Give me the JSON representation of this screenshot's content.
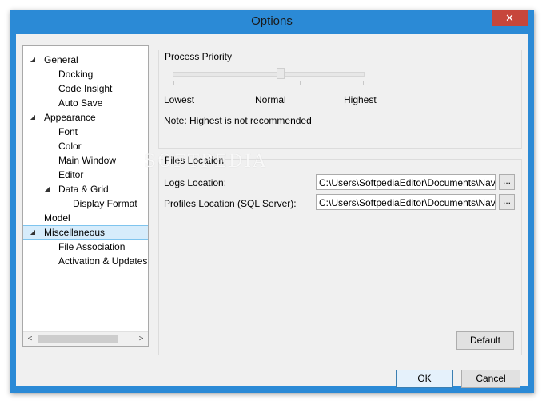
{
  "window": {
    "title": "Options",
    "close_glyph": "✕"
  },
  "tree": {
    "items": [
      {
        "label": "General",
        "expanded": true
      },
      {
        "label": "Docking"
      },
      {
        "label": "Code Insight"
      },
      {
        "label": "Auto Save"
      },
      {
        "label": "Appearance",
        "expanded": true
      },
      {
        "label": "Font"
      },
      {
        "label": "Color"
      },
      {
        "label": "Main Window"
      },
      {
        "label": "Editor"
      },
      {
        "label": "Data & Grid",
        "expanded": true
      },
      {
        "label": "Display Format"
      },
      {
        "label": "Model"
      },
      {
        "label": "Miscellaneous",
        "expanded": true,
        "selected": true
      },
      {
        "label": "File Association"
      },
      {
        "label": "Activation & Updates"
      }
    ],
    "expand_glyph": "◢",
    "scroll_left": "<",
    "scroll_right": ">"
  },
  "process_priority": {
    "title": "Process Priority",
    "labels": {
      "low": "Lowest",
      "mid": "Normal",
      "high": "Highest"
    },
    "value": "Normal",
    "note": "Note: Highest is not recommended"
  },
  "files_location": {
    "title": "Files Location",
    "logs_label": "Logs Location:",
    "logs_value": "C:\\Users\\SoftpediaEditor\\Documents\\Navicat",
    "profiles_label": "Profiles Location (SQL Server):",
    "profiles_value": "C:\\Users\\SoftpediaEditor\\Documents\\Navicat",
    "browse_label": "..."
  },
  "buttons": {
    "default": "Default",
    "ok": "OK",
    "cancel": "Cancel"
  },
  "watermark": "SOFTPEDIA",
  "colors": {
    "accent": "#2b8ad6",
    "selection": "#d6ecfb",
    "close": "#c7463b"
  }
}
